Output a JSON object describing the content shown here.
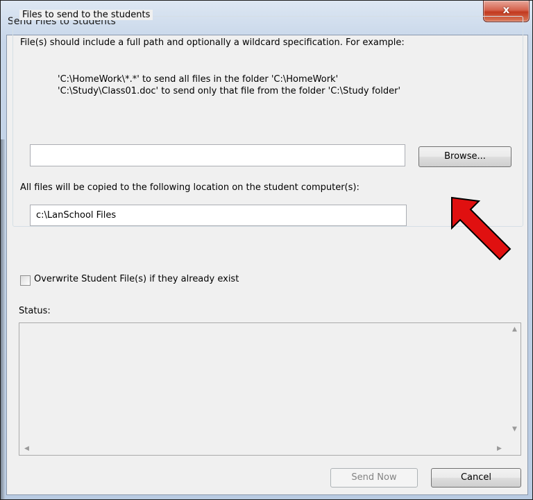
{
  "window": {
    "title": "Send Files to Students",
    "close_glyph": "x"
  },
  "files_group": {
    "legend": "Files to send to the students",
    "description": "File(s) should include a full path and optionally a wildcard specification. For example:",
    "example_1": "'C:\\HomeWork\\*.*' to send all files in the folder 'C:\\HomeWork'",
    "example_2": "'C:\\Study\\Class01.doc' to send only that file from the folder 'C:\\Study folder'",
    "path_value": "",
    "browse_label": "Browse...",
    "copy_label": "All files will be copied to the following location on the student computer(s):",
    "destination_value": "c:\\LanSchool Files"
  },
  "overwrite": {
    "label": "Overwrite Student File(s) if they already exist",
    "checked": false
  },
  "status": {
    "label": "Status:",
    "text": ""
  },
  "buttons": {
    "send_label": "Send Now",
    "cancel_label": "Cancel"
  },
  "colors": {
    "annotation_arrow": "#e01010",
    "close_button": "#c9452c"
  },
  "icons": [
    "close-icon",
    "red-arrow-annotation",
    "scroll-up-icon",
    "scroll-down-icon",
    "scroll-left-icon",
    "scroll-right-icon"
  ]
}
